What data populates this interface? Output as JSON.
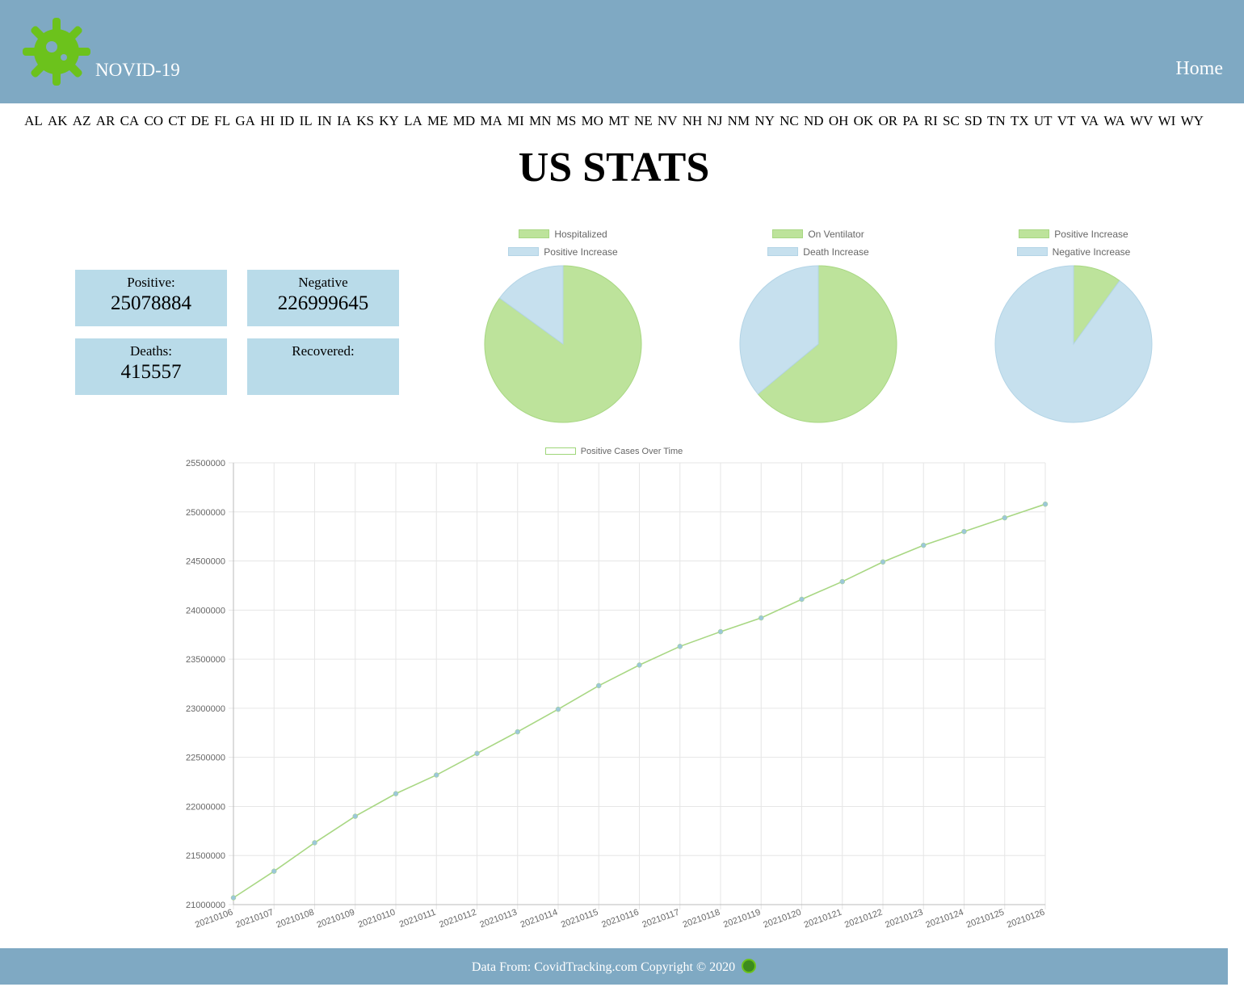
{
  "header": {
    "brand": "NOVID-19",
    "home_label": "Home",
    "logo_icon": "virus-gear-icon",
    "background": "#7fa9c3",
    "logo_color": "#6cc21c"
  },
  "states": [
    "AL",
    "AK",
    "AZ",
    "AR",
    "CA",
    "CO",
    "CT",
    "DE",
    "FL",
    "GA",
    "HI",
    "ID",
    "IL",
    "IN",
    "IA",
    "KS",
    "KY",
    "LA",
    "ME",
    "MD",
    "MA",
    "MI",
    "MN",
    "MS",
    "MO",
    "MT",
    "NE",
    "NV",
    "NH",
    "NJ",
    "NM",
    "NY",
    "NC",
    "ND",
    "OH",
    "OK",
    "OR",
    "PA",
    "RI",
    "SC",
    "SD",
    "TN",
    "TX",
    "UT",
    "VT",
    "VA",
    "WA",
    "WV",
    "WI",
    "WY"
  ],
  "page_title": "US STATS",
  "stats": {
    "positive": {
      "label": "Positive:",
      "value": "25078884"
    },
    "negative": {
      "label": "Negative",
      "value": "226999645"
    },
    "deaths": {
      "label": "Deaths:",
      "value": "415557"
    },
    "recovered": {
      "label": "Recovered:",
      "value": ""
    }
  },
  "chart_data": [
    {
      "type": "pie",
      "labels": [
        "Hospitalized",
        "Positive Increase"
      ],
      "values": [
        85,
        15
      ],
      "colors": [
        "#bde39b",
        "#c6e0ee"
      ]
    },
    {
      "type": "pie",
      "labels": [
        "On Ventilator",
        "Death Increase"
      ],
      "values": [
        64,
        36
      ],
      "colors": [
        "#bde39b",
        "#c6e0ee"
      ]
    },
    {
      "type": "pie",
      "labels": [
        "Positive Increase",
        "Negative Increase"
      ],
      "values": [
        10,
        90
      ],
      "colors": [
        "#bde39b",
        "#c6e0ee"
      ]
    },
    {
      "type": "line",
      "series": [
        {
          "name": "Positive Cases Over Time",
          "values": [
            21070000,
            21340000,
            21630000,
            21900000,
            22130000,
            22320000,
            22540000,
            22760000,
            22990000,
            23230000,
            23440000,
            23630000,
            23780000,
            23920000,
            24110000,
            24290000,
            24490000,
            24660000,
            24800000,
            24940000,
            25078884
          ]
        }
      ],
      "categories": [
        "20210106",
        "20210107",
        "20210108",
        "20210109",
        "20210110",
        "20210111",
        "20210112",
        "20210113",
        "20210114",
        "20210115",
        "20210116",
        "20210117",
        "20210118",
        "20210119",
        "20210120",
        "20210121",
        "20210122",
        "20210123",
        "20210124",
        "20210125",
        "20210126"
      ],
      "ylim": [
        21000000,
        25500000
      ],
      "yticks": [
        "25500000",
        "25000000",
        "24500000",
        "24000000",
        "23500000",
        "23000000",
        "22500000",
        "22000000",
        "21500000",
        "21000000"
      ],
      "grid": true,
      "legend": "top",
      "line_color": "#a8d783",
      "point_color": "#9cc7d9"
    }
  ],
  "footer": {
    "text": "Data From: CovidTracking.com Copyright © 2020",
    "icon": "virus-icon"
  }
}
